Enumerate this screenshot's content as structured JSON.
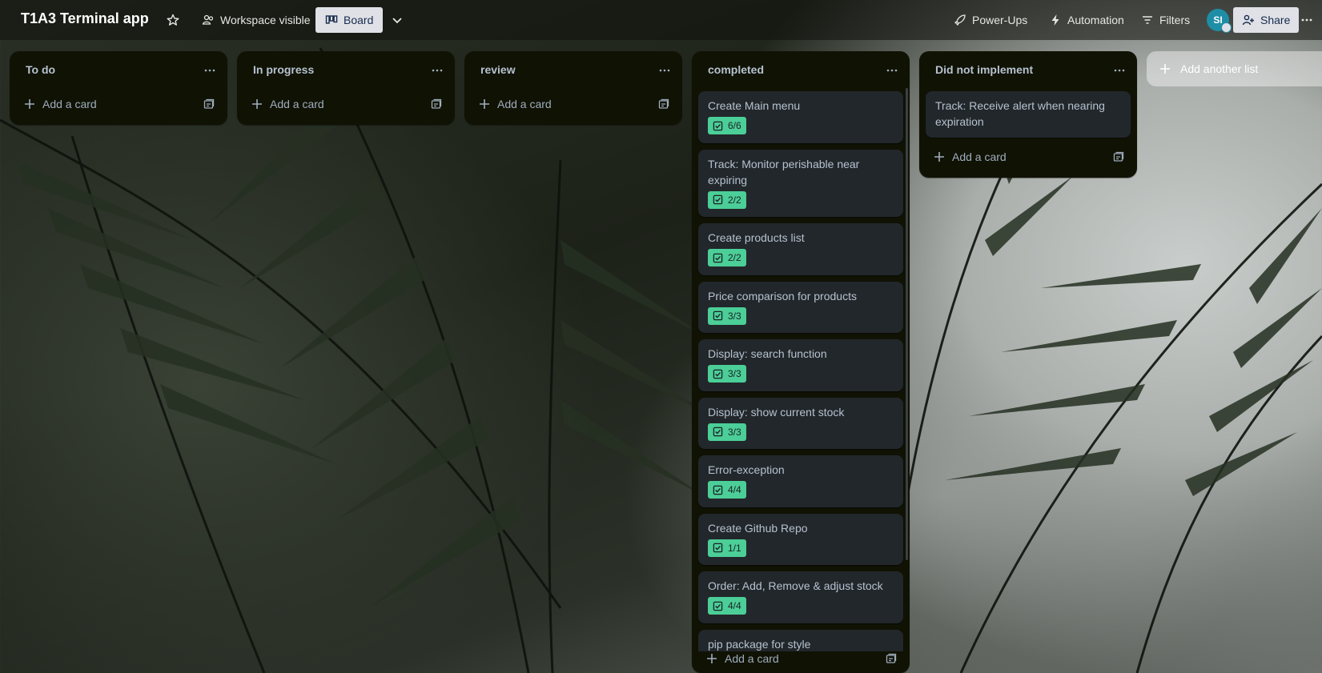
{
  "header": {
    "board_title": "T1A3 Terminal app",
    "visibility_label": "Workspace visible",
    "view_label": "Board",
    "powerups_label": "Power-Ups",
    "automation_label": "Automation",
    "filters_label": "Filters",
    "avatar_initials": "SI",
    "share_label": "Share"
  },
  "lists": [
    {
      "title": "To do",
      "add_card_label": "Add a card",
      "cards": []
    },
    {
      "title": "In progress",
      "add_card_label": "Add a card",
      "cards": []
    },
    {
      "title": "review",
      "add_card_label": "Add a card",
      "cards": []
    },
    {
      "title": "completed",
      "add_card_label": "Add a card",
      "cards": [
        {
          "title": "Create Main menu",
          "checklist": "6/6"
        },
        {
          "title": "Track: Monitor perishable near expiring",
          "checklist": "2/2"
        },
        {
          "title": "Create products list",
          "checklist": "2/2"
        },
        {
          "title": "Price comparison for products",
          "checklist": "3/3"
        },
        {
          "title": "Display: search function",
          "checklist": "3/3"
        },
        {
          "title": "Display: show current stock",
          "checklist": "3/3"
        },
        {
          "title": "Error-exception",
          "checklist": "4/4"
        },
        {
          "title": "Create Github Repo",
          "checklist": "1/1"
        },
        {
          "title": "Order: Add, Remove & adjust stock",
          "checklist": "4/4"
        },
        {
          "title": "pip package for style",
          "checklist": ""
        }
      ]
    },
    {
      "title": "Did not implement",
      "add_card_label": "Add a card",
      "cards": [
        {
          "title": "Track: Receive alert when nearing expiration",
          "checklist": ""
        }
      ]
    }
  ],
  "add_list_label": "Add another list",
  "colors": {
    "list_bg": "#101204",
    "card_bg": "#22272b",
    "checklist_complete": "#4bce97",
    "text": "#b6c2cf"
  },
  "icons": [
    "star-icon",
    "workspace-visible-icon",
    "board-icon",
    "chevron-down-icon",
    "rocket-icon",
    "lightning-icon",
    "filter-icon",
    "add-person-icon",
    "more-icon",
    "plus-icon",
    "card-template-icon",
    "checklist-icon"
  ]
}
